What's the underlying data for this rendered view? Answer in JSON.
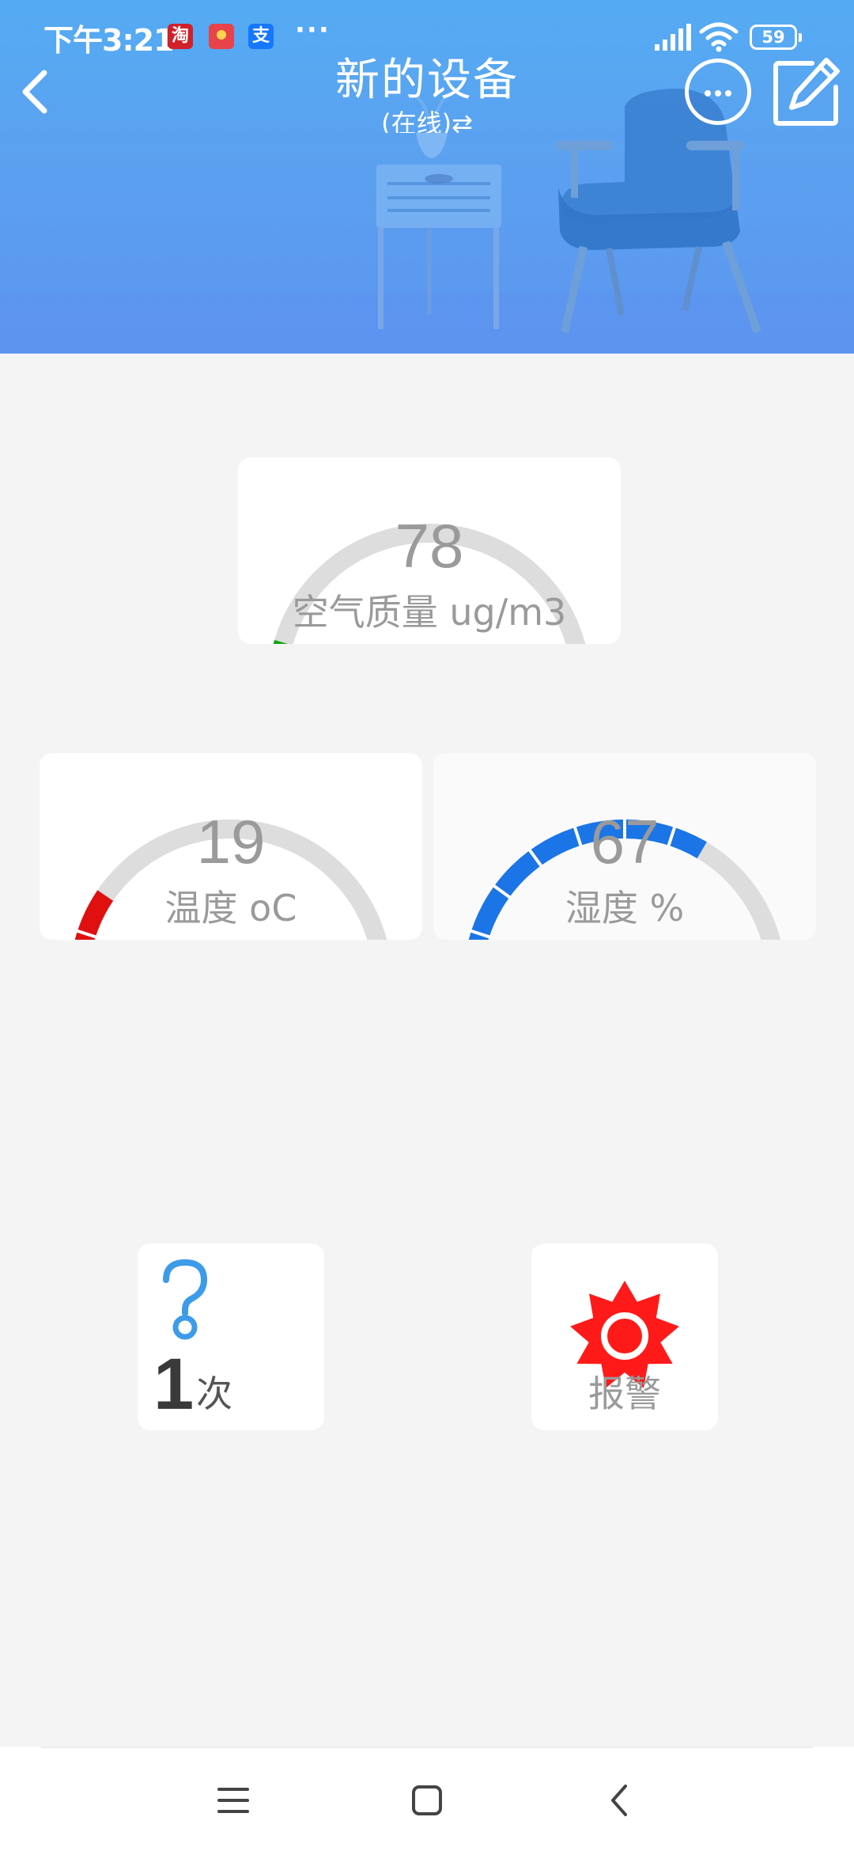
{
  "status_bar": {
    "time": "下午3:21",
    "apps": [
      {
        "name": "taobao-icon",
        "glyph": "淘",
        "color": "#d0202a"
      },
      {
        "name": "red-packet-icon",
        "glyph": "",
        "color": "#e8424a"
      },
      {
        "name": "alipay-icon",
        "glyph": "支",
        "color": "#1677ff"
      }
    ],
    "more": "···",
    "battery": "59"
  },
  "header": {
    "title": "新的设备",
    "subtitle": "(在线)⇄"
  },
  "gauges": {
    "air_quality": {
      "value": "78",
      "label": "空气质量 ug/m3",
      "color": "#0ca30c",
      "level": 0.09
    },
    "temperature": {
      "value": "19",
      "label": "温度 oC",
      "color": "#e01010",
      "level": 0.19
    },
    "humidity": {
      "value": "67",
      "label": "湿度 %",
      "color": "#1b75e6",
      "level": 0.67
    }
  },
  "tiles": {
    "count": {
      "value": "1",
      "unit": "次"
    },
    "alarm": {
      "label": "报警",
      "color": "#ff1a1a"
    }
  },
  "colors": {
    "header_top": "#4fb0f4",
    "header_bottom": "#5c8ef0",
    "page_background": "#f4f4f4",
    "gauge_track": "#dddddd",
    "question_icon": "#3d9be9"
  }
}
